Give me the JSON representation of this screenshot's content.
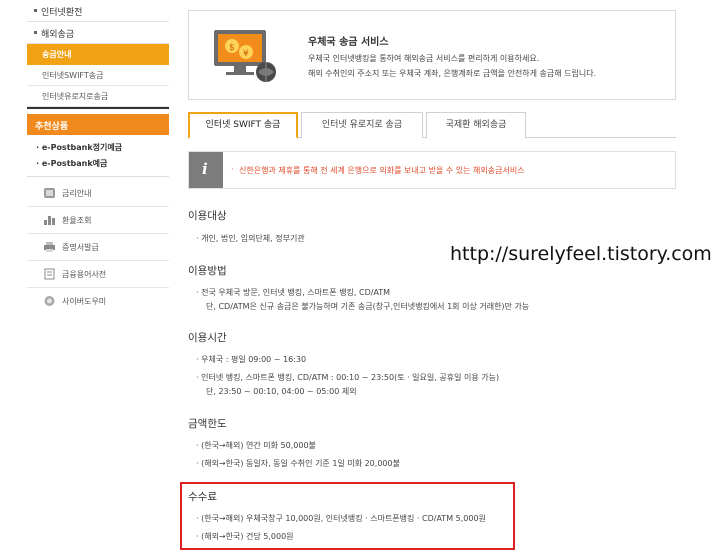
{
  "sidebar": {
    "top_items": [
      "인터넷환전",
      "해외송금"
    ],
    "sub_items": [
      "송금안내",
      "인터넷SWIFT송금",
      "인터넷유로지로송금"
    ],
    "recommend_title": "추천상품",
    "recommend_items": [
      "e-Postbank정기예금",
      "e-Postbank예금"
    ],
    "services": [
      {
        "label": "금리안내",
        "icon": "coin-icon"
      },
      {
        "label": "환율조회",
        "icon": "bar-chart-icon"
      },
      {
        "label": "증명서발급",
        "icon": "printer-icon"
      },
      {
        "label": "금융용어사전",
        "icon": "book-icon"
      },
      {
        "label": "사이버도우미",
        "icon": "helper-icon"
      }
    ]
  },
  "intro": {
    "title": "우체국 송금 서비스",
    "line1": "우체국 인터넷뱅킹을 통하여 해외송금 서비스를 편리하게 이용하세요.",
    "line2": "해외 수취인의 주소지 또는 우체국 계좌, 은행계좌로 금액을 안전하게 송금해 드립니다."
  },
  "tabs": [
    "인터넷 SWIFT 송금",
    "인터넷 유로지로 송금",
    "국제환 해외송금"
  ],
  "notice": {
    "icon": "info-icon",
    "text": "신한은행과 제휴를 통해 전 세계 은행으로 외화를 보내고 받을 수 있는 해외송금서비스"
  },
  "sections": {
    "target": {
      "title": "이용대상",
      "item1": "개인, 법인, 임의단체, 정부기관"
    },
    "method": {
      "title": "이용방법",
      "item1": "전국 우체국 방문, 인터넷 뱅킹, 스마트폰 뱅킹, CD/ATM",
      "item1_cont": "단, CD/ATM은 신규 송금은 불가능하며 기존 송금(창구,인터넷뱅킹에서 1회 이상 거래한)만 가능"
    },
    "hours": {
      "title": "이용시간",
      "item1": "우체국 : 평일 09:00 ~ 16:30",
      "item2": "인터넷 뱅킹, 스마트폰 뱅킹, CD/ATM : 00:10 ~ 23:50(토 · 일요일, 공휴일 이용 가능)",
      "item2_cont": "단, 23:50 ~ 00:10, 04:00 ~ 05:00 제외"
    },
    "limit": {
      "title": "금액한도",
      "item1": "(한국→해외) 연간 미화 50,000불",
      "item2": "(해외→한국) 동일자, 동일 수취인 기준 1일 미화 20,000불"
    },
    "fee": {
      "title": "수수료",
      "item1": "(한국→해외) 우체국창구 10,000원, 인터넷뱅킹 · 스마트폰뱅킹 · CD/ATM 5,000원",
      "item2": "(해외→한국) 건당 5,000원"
    }
  },
  "watermark": "http://surelyfeel.tistory.com",
  "colors": {
    "accent": "#f2a313",
    "recommend": "#f08a1c",
    "notice_text": "#e04b2a",
    "highlight_box": "#e1211f"
  }
}
